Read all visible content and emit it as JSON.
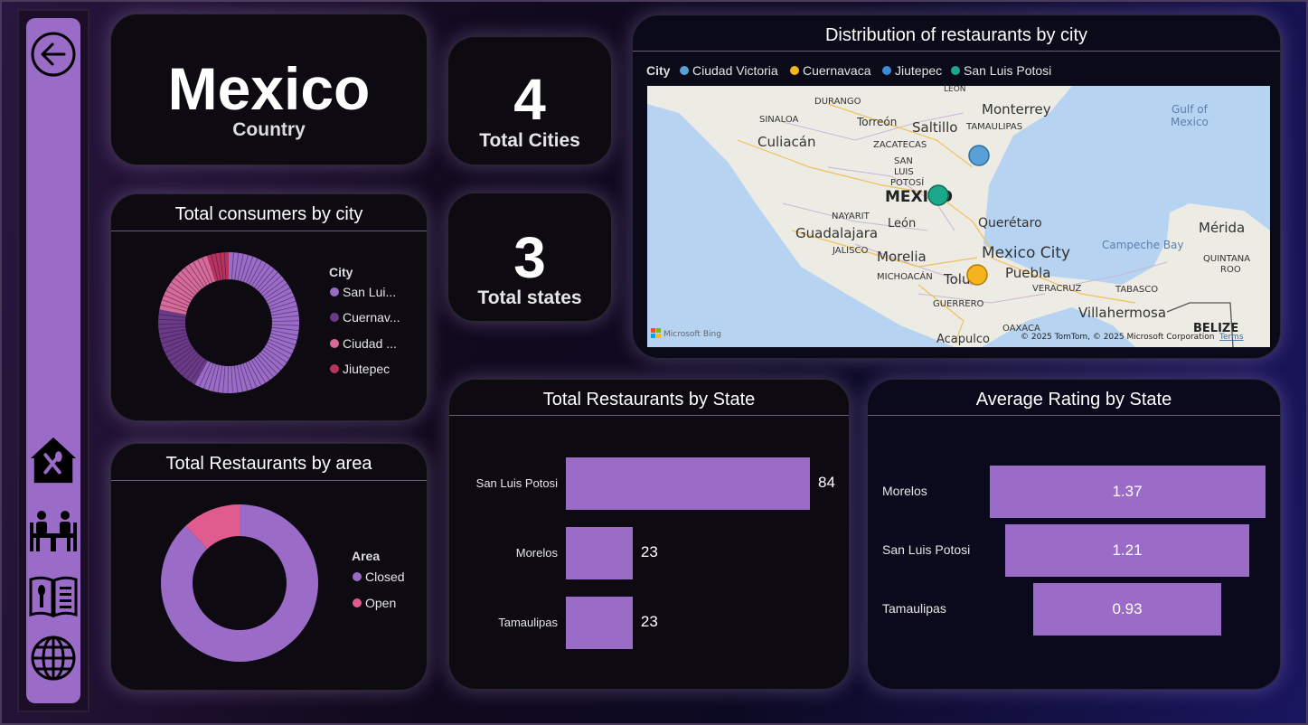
{
  "colors": {
    "accent": "#9b6bc8",
    "pink": "#e05c8e",
    "dark_purple": "#6a3a86",
    "mid_pink": "#d66a98",
    "crimson": "#b8325e",
    "map_blue": "#5aa0d8",
    "map_yellow": "#f5b41e",
    "map_teal": "#1aa88a"
  },
  "sidebar": {
    "items": [
      {
        "icon": "back-arrow-icon"
      },
      {
        "icon": "restaurant-home-icon"
      },
      {
        "icon": "dining-table-icon"
      },
      {
        "icon": "menu-book-icon"
      },
      {
        "icon": "globe-icon"
      }
    ]
  },
  "country_card": {
    "value": "Mexico",
    "label": "Country"
  },
  "kpi_cities": {
    "value": "4",
    "label": "Total Cities"
  },
  "kpi_states": {
    "value": "3",
    "label": "Total states"
  },
  "consumers_chart": {
    "title": "Total consumers by city",
    "legend_title": "City",
    "legend": [
      "San Lui...",
      "Cuernav...",
      "Ciudad ...",
      "Jiutepec"
    ]
  },
  "area_chart": {
    "title": "Total Restaurants by area",
    "legend_title": "Area",
    "legend": [
      "Closed",
      "Open"
    ]
  },
  "map": {
    "title": "Distribution of restaurants by city",
    "legend_title": "City",
    "legend": [
      "Ciudad Victoria",
      "Cuernavaca",
      "Jiutepec",
      "San Luis Potosi"
    ],
    "place_labels": {
      "durango": "DURANGO",
      "leon_top": "LEÓN",
      "monterrey": "Monterrey",
      "gulf": "Gulf of",
      "mexico_sea": "Mexico",
      "sinaloa": "SINALOA",
      "torreon": "Torreón",
      "saltillo": "Saltillo",
      "tamaulipas": "TAMAULIPAS",
      "culiacan": "Culiacán",
      "zacatecas": "ZACATECAS",
      "san": "SAN",
      "luis": "LUIS",
      "potosi": "POTOSÍ",
      "mexico_big": "MEXICO",
      "nayarit": "NAYARIT",
      "leon": "León",
      "queretaro": "Querétaro",
      "merida": "Mérida",
      "guadalajara": "Guadalajara",
      "jalisco": "JALISCO",
      "mexico_city": "Mexico City",
      "campeche": "Campeche Bay",
      "morelia": "Morelia",
      "puebla": "Puebla",
      "quintana": "QUINTANA",
      "roo": "ROO",
      "michoacan": "MICHOACÁN",
      "toluca": "Tolu",
      "veracruz": "VERACRUZ",
      "tabasco": "TABASCO",
      "guerrero": "GUERRERO",
      "villahermosa": "Villahermosa",
      "oaxaca": "OAXACA",
      "belize": "BELIZE",
      "acapulco": "Acapulco"
    },
    "bing": "Microsoft Bing",
    "copyright": "© 2025 TomTom, © 2025 Microsoft Corporation",
    "terms": "Terms"
  },
  "restaurants_by_state": {
    "title": "Total Restaurants by State"
  },
  "rating_by_state": {
    "title": "Average Rating by State"
  },
  "chart_data": [
    {
      "type": "pie",
      "title": "Total consumers by city",
      "legend_title": "City",
      "categories": [
        "San Lui...",
        "Cuernav...",
        "Ciudad ...",
        "Jiutepec"
      ],
      "values": [
        0.58,
        0.2,
        0.17,
        0.05
      ],
      "colors": [
        "#9b6bc8",
        "#6a3a86",
        "#d66a98",
        "#b8325e"
      ]
    },
    {
      "type": "pie",
      "title": "Total Restaurants by area",
      "legend_title": "Area",
      "categories": [
        "Closed",
        "Open"
      ],
      "values": [
        0.88,
        0.12
      ],
      "colors": [
        "#9b6bc8",
        "#e05c8e"
      ]
    },
    {
      "type": "bar",
      "orientation": "horizontal",
      "title": "Total Restaurants by State",
      "categories": [
        "San Luis Potosi",
        "Morelos",
        "Tamaulipas"
      ],
      "values": [
        84,
        23,
        23
      ]
    },
    {
      "type": "bar",
      "orientation": "horizontal-centered",
      "title": "Average Rating by State",
      "categories": [
        "Morelos",
        "San Luis Potosi",
        "Tamaulipas"
      ],
      "values": [
        1.37,
        1.21,
        0.93
      ]
    }
  ]
}
